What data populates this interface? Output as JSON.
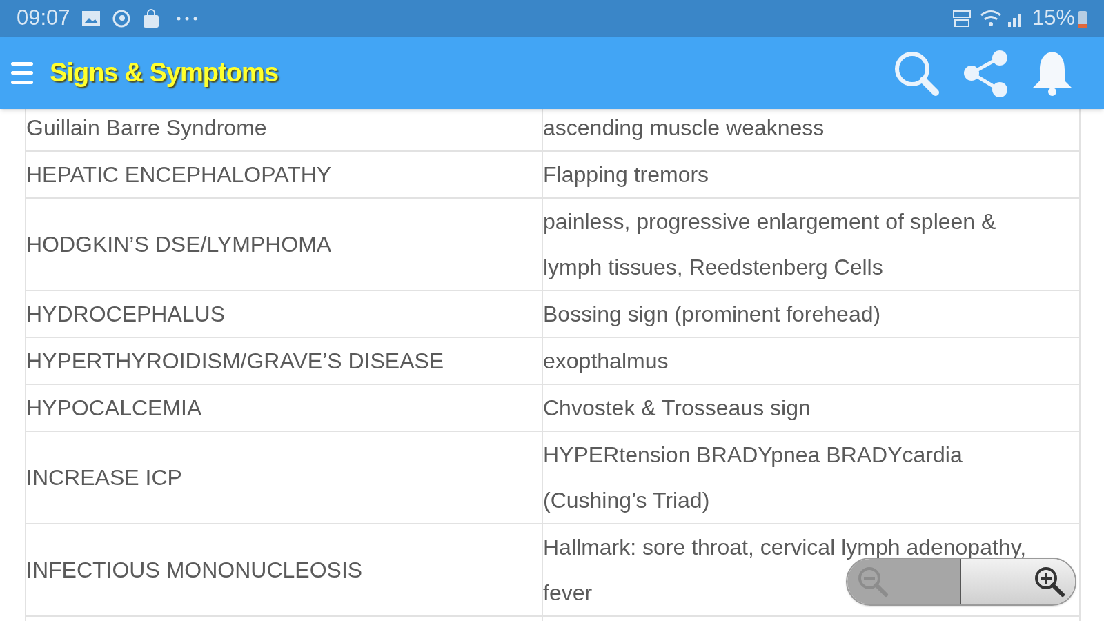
{
  "status_bar": {
    "time": "09:07",
    "battery": "15%"
  },
  "app_bar": {
    "title": "Signs & Symptoms"
  },
  "table": {
    "rows": [
      {
        "condition": "Guillain Barre Syndrome",
        "sign": "ascending muscle weakness"
      },
      {
        "condition": "HEPATIC ENCEPHALOPATHY",
        "sign": "Flapping tremors"
      },
      {
        "condition": "HODGKIN’S DSE/LYMPHOMA",
        "sign": "painless, progressive enlargement of spleen & lymph tissues, Reedstenberg Cells"
      },
      {
        "condition": "HYDROCEPHALUS",
        "sign": "Bossing sign (prominent forehead)"
      },
      {
        "condition": "HYPERTHYROIDISM/GRAVE’S DISEASE",
        "sign": "exopthalmus"
      },
      {
        "condition": "HYPOCALCEMIA",
        "sign": "Chvostek & Trosseaus sign"
      },
      {
        "condition": "INCREASE ICP",
        "sign": "HYPERtension BRADYpnea BRADYcardia (Cushing’s Triad)"
      },
      {
        "condition": "INFECTIOUS MONONUCLEOSIS",
        "sign": "Hallmark: sore throat, cervical lymph adenopathy, fever"
      }
    ]
  },
  "zoom_control": {
    "zoom_out_disabled": true,
    "zoom_in_disabled": false
  }
}
